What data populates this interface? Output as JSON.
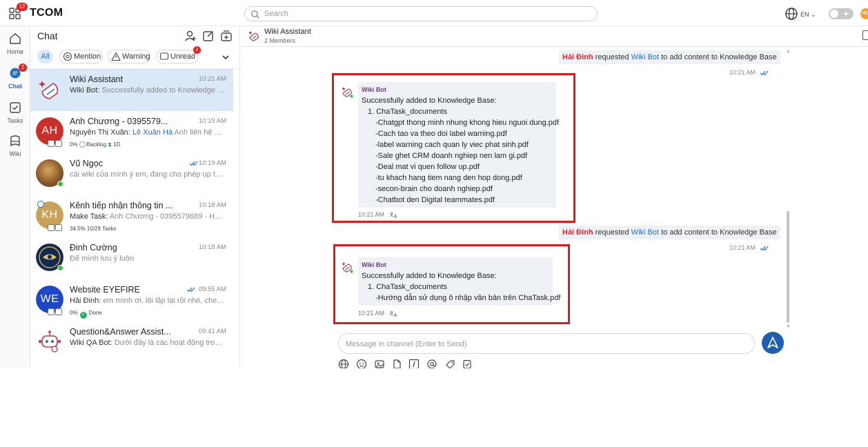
{
  "topbar": {
    "apps_badge": "12",
    "brand": "TCOM",
    "search_placeholder": "Search",
    "lang": "EN",
    "user_initials": "HĐ"
  },
  "rail": [
    {
      "label": "Home",
      "icon": "home-icon"
    },
    {
      "label": "Chat",
      "icon": "chat-icon",
      "badge": "2"
    },
    {
      "label": "Tasks",
      "icon": "tasks-icon"
    },
    {
      "label": "Wiki",
      "icon": "wiki-icon"
    }
  ],
  "chat_panel": {
    "title": "Chat",
    "filters": {
      "all": "All",
      "mention": "Mention",
      "warning": "Warning",
      "unread": "Unread",
      "unread_badge": "2"
    },
    "rows": [
      {
        "name": "Wiki Assistant",
        "time": "10:21 AM",
        "sender": "Wiki Bot:",
        "preview": "Successfully added to Knowledge B..."
      },
      {
        "name": "Anh Chương - 0395579...",
        "time": "10:19 AM",
        "initials": "AH",
        "sender": "Nguyễn Thị Xuân:",
        "mention": "Lê Xuân Hà",
        "preview": "Anh liên hệ giú...",
        "meta_percent": "0%",
        "meta_status": "Backlog",
        "meta_duration": "1D"
      },
      {
        "name": "Vũ Ngọc",
        "time": "10:19 AM",
        "preview": "cái wiki của mình ý em, đang cho phép up tài l..."
      },
      {
        "name": "Kênh tiếp nhận thông tin ...",
        "time": "10:18 AM",
        "initials": "KH",
        "sender": "Make Task:",
        "preview": "Anh Chương - 0395579689 - Hợ...",
        "meta_percent": "34.5%",
        "meta_tasks": "10/29 Tasks"
      },
      {
        "name": "Đinh Cường",
        "time": "10:18 AM",
        "preview": "Để mình lưu ý luôn"
      },
      {
        "name": "Website EYEFIRE",
        "time": "09:55 AM",
        "initials": "WE",
        "sender": "Hải Đinh:",
        "preview": "em mình ơi, lỗi lặp lại rồi nhé, check g...",
        "meta_percent": "0%",
        "meta_status": "Done"
      },
      {
        "name": "Question&Answer Assist...",
        "time": "09:41 AM",
        "sender": "Wiki QA Bot:",
        "preview": "Dưới đây là các hoạt động trong t..."
      }
    ]
  },
  "conversation": {
    "title": "Wiki Assistant",
    "members": "2 Members",
    "notice": {
      "actor": "Hải Đinh",
      "verb": "requested",
      "bot": "Wiki Bot",
      "rest": "to add content to Knowledge Base"
    },
    "notice_time": "10:21 AM",
    "messages": [
      {
        "sender": "Wiki Bot",
        "lines": [
          "Successfully added to Knowledge Base:",
          "1. ChaTask_documents",
          "-Chatgpt thong minh nhung khong hieu nguoi dung.pdf",
          "-Cach tao va theo doi label warning.pdf",
          "-label warning cach quan ly viec phat sinh.pdf",
          "-Sale ghet CRM doanh nghiep nen lam gi.pdf",
          "-Deal mat vi quen follow up.pdf",
          "-tu khach hang tiem nang den hop dong.pdf",
          "-secon-brain cho doanh nghiep.pdf",
          "-Chatbot den Digital teammates.pdf"
        ],
        "time": "10:21 AM"
      },
      {
        "sender": "Wiki Bot",
        "lines": [
          "Successfully added to Knowledge Base:",
          "1. ChaTask_documents",
          "-Hướng dẫn sử dụng ô nhập văn bản trên ChaTask.pdf"
        ],
        "time": "10:21 AM"
      }
    ],
    "composer_placeholder": "Message in channel (Enter to Send)",
    "tools": [
      "globe-icon",
      "emoji-icon",
      "image-icon",
      "file-icon",
      "format-icon",
      "mention-icon",
      "sticker-icon",
      "task-icon"
    ]
  },
  "colors": {
    "accent": "#1f6fc8",
    "highlight": "#d31f1f",
    "send": "#1e5fae",
    "selected_row": "#dbe8f7"
  }
}
